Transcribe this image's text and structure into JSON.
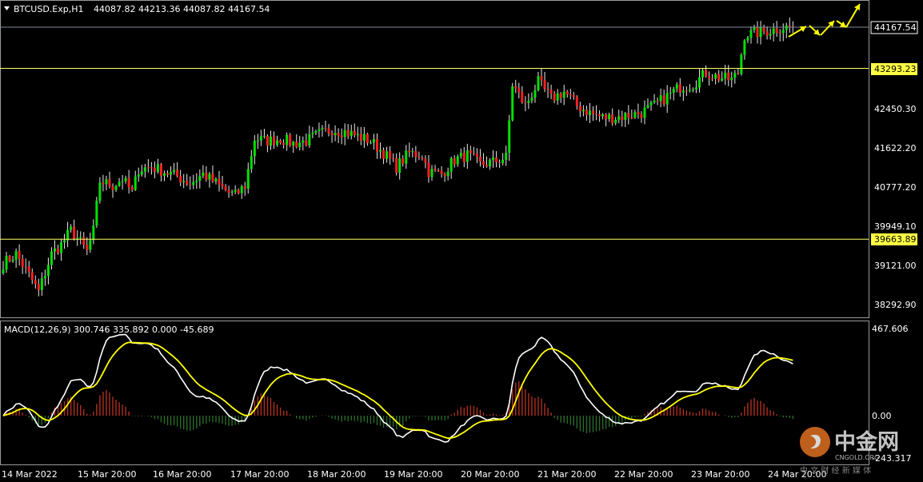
{
  "header": {
    "symbol": "BTCUSD.Exp,H1",
    "ohlc": "44087.82 44213.36 44087.82 44167.54",
    "menu_icon": "triangle-down-icon"
  },
  "colors": {
    "background": "#000000",
    "bull": "#00e000",
    "bear": "#ff2020",
    "wick": "#e8e8e8",
    "level_line": "#ffff66",
    "price_line": "#7f8c99",
    "macd_line": "#ffffff",
    "signal_line": "#ffff00",
    "hist_pos": "#b03020",
    "hist_neg": "#2a6a2a",
    "forecast_arrow": "#ffff00"
  },
  "price_axis": {
    "current_price": "44167.54",
    "levels": [
      "43293.23",
      "39663.89"
    ],
    "ticks": [
      "42450.30",
      "41622.20",
      "40777.20",
      "39949.10",
      "39121.00",
      "38292.90"
    ]
  },
  "macd": {
    "label": "MACD(12,26,9) 300.746 335.892 0.000 -45.689",
    "ticks": [
      "467.606",
      "0.00",
      "-243.317"
    ]
  },
  "time_axis": {
    "labels": [
      "14 Mar 2022",
      "15 Mar 20:00",
      "16 Mar 20:00",
      "17 Mar 20:00",
      "18 Mar 20:00",
      "19 Mar 20:00",
      "20 Mar 20:00",
      "21 Mar 20:00",
      "22 Mar 20:00",
      "23 Mar 20:00",
      "24 Mar 20:00"
    ]
  },
  "watermark": {
    "brand": "中金网",
    "domain": "CNGOLD.ORG",
    "tagline": "中 文 财 经 新 媒 体"
  },
  "chart_data": [
    {
      "type": "candlestick",
      "symbol": "BTCUSD.Exp",
      "timeframe": "H1",
      "x_range": [
        "14 Mar 2022",
        "24 Mar 2022 20:00"
      ],
      "y_range": [
        38000,
        44500
      ],
      "price_path": [
        [
          0,
          39150
        ],
        [
          4,
          39350
        ],
        [
          8,
          38900
        ],
        [
          11,
          38550
        ],
        [
          15,
          39350
        ],
        [
          18,
          39550
        ],
        [
          21,
          39850
        ],
        [
          24,
          39600
        ],
        [
          26,
          39400
        ],
        [
          28,
          39850
        ],
        [
          30,
          40900
        ],
        [
          34,
          40800
        ],
        [
          37,
          40950
        ],
        [
          40,
          40650
        ],
        [
          42,
          41150
        ],
        [
          46,
          41200
        ],
        [
          50,
          41100
        ],
        [
          54,
          41000
        ],
        [
          58,
          40850
        ],
        [
          62,
          41050
        ],
        [
          66,
          40850
        ],
        [
          70,
          40650
        ],
        [
          72,
          40600
        ],
        [
          75,
          40800
        ],
        [
          78,
          41800
        ],
        [
          82,
          41750
        ],
        [
          86,
          41800
        ],
        [
          90,
          41700
        ],
        [
          94,
          41750
        ],
        [
          98,
          41900
        ],
        [
          102,
          42000
        ],
        [
          106,
          41950
        ],
        [
          110,
          41850
        ],
        [
          114,
          41750
        ],
        [
          118,
          41500
        ],
        [
          122,
          41200
        ],
        [
          126,
          41500
        ],
        [
          130,
          41450
        ],
        [
          132,
          41100
        ],
        [
          136,
          41050
        ],
        [
          140,
          41350
        ],
        [
          144,
          41450
        ],
        [
          148,
          41250
        ],
        [
          152,
          41300
        ],
        [
          156,
          41400
        ],
        [
          158,
          42950
        ],
        [
          162,
          42500
        ],
        [
          166,
          43000
        ],
        [
          170,
          42650
        ],
        [
          174,
          42800
        ],
        [
          178,
          42500
        ],
        [
          182,
          42350
        ],
        [
          186,
          42250
        ],
        [
          190,
          42250
        ],
        [
          194,
          42300
        ],
        [
          198,
          42350
        ],
        [
          202,
          42500
        ],
        [
          206,
          42700
        ],
        [
          210,
          42900
        ],
        [
          214,
          42950
        ],
        [
          218,
          43200
        ],
        [
          222,
          43100
        ],
        [
          226,
          43050
        ],
        [
          228,
          43200
        ],
        [
          230,
          44000
        ],
        [
          234,
          44050
        ],
        [
          238,
          44100
        ],
        [
          242,
          44167.54
        ]
      ],
      "horizontal_levels": [
        43293.23,
        39663.89
      ],
      "current_price": 44167.54
    },
    {
      "type": "line",
      "indicator": "MACD(12,26,9)",
      "values": {
        "macd": 300.746,
        "signal": 335.892,
        "level": 0.0,
        "histogram": -45.689
      },
      "ylim": [
        -243.317,
        467.606
      ]
    }
  ]
}
